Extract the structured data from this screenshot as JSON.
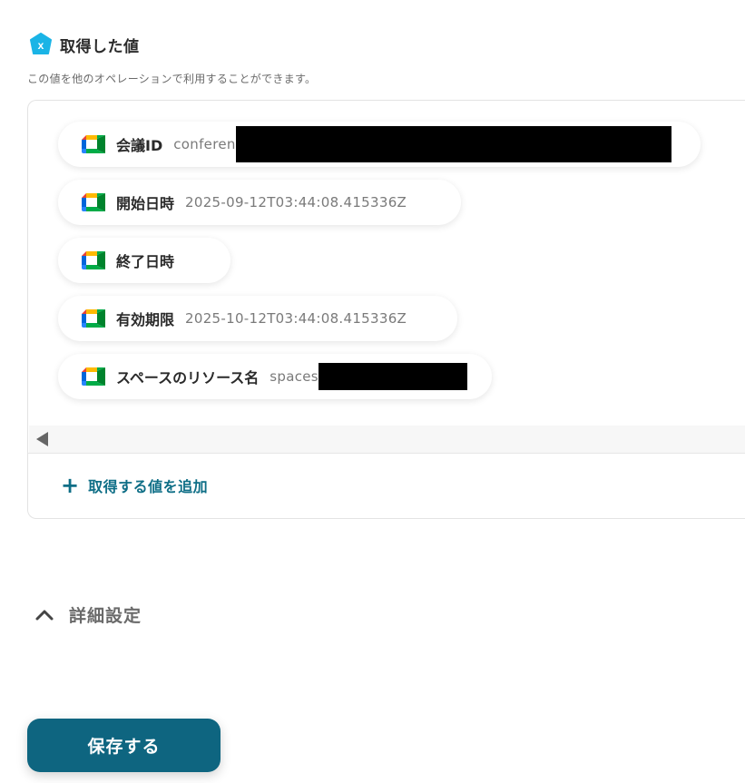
{
  "header": {
    "title": "取得した値",
    "description": "この値を他のオペレーションで利用することができます。",
    "icon": "variable-x-hex-icon",
    "icon_color": "#1ab4e6"
  },
  "values": [
    {
      "label": "会議ID",
      "value": "conferen",
      "redacted": true,
      "icon": "google-meet-icon"
    },
    {
      "label": "開始日時",
      "value": "2025-09-12T03:44:08.415336Z",
      "redacted": false,
      "icon": "google-meet-icon"
    },
    {
      "label": "終了日時",
      "value": "",
      "redacted": false,
      "icon": "google-meet-icon"
    },
    {
      "label": "有効期限",
      "value": "2025-10-12T03:44:08.415336Z",
      "redacted": false,
      "icon": "google-meet-icon"
    },
    {
      "label": "スペースのリソース名",
      "value": "spaces",
      "redacted": true,
      "icon": "google-meet-icon"
    }
  ],
  "add_value": {
    "label": "取得する値を追加",
    "icon": "plus-icon"
  },
  "advanced": {
    "label": "詳細設定",
    "icon": "chevron-up-icon",
    "expanded": true
  },
  "save_button": {
    "label": "保存する",
    "color": "#0e6580"
  },
  "colors": {
    "accent": "#0e6e86",
    "meet_green": "#00832d",
    "meet_blue": "#0066da",
    "meet_yellow": "#ffba00",
    "meet_red": "#e94235"
  }
}
